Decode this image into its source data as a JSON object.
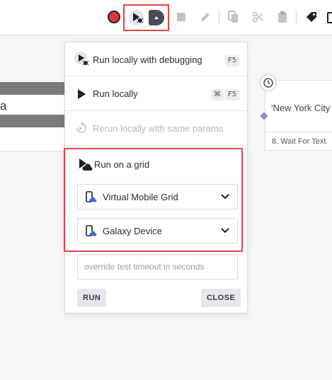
{
  "toolbar": {
    "icons": [
      "record-icon",
      "run-debug-icon",
      "dropdown-arrow-icon",
      "stop-icon",
      "pencil-icon",
      "copy-icon",
      "scissors-icon",
      "clipboard-icon",
      "tag-icon"
    ],
    "record_color": "#e8323c",
    "highlight_color": "#e24646"
  },
  "canvas": {
    "left_node_text": "a",
    "right_node_text": "'New York City",
    "right_node_step": "8. Wait For Text"
  },
  "menu": {
    "items": [
      {
        "label": "Run locally with debugging",
        "shortcut": "F5"
      },
      {
        "label": "Run locally",
        "shortcut_mod": "⌘",
        "shortcut": "F5"
      },
      {
        "label": "Rerun locally with same params",
        "disabled": true
      }
    ],
    "grid": {
      "title": "Run on a grid",
      "grid_select": "Virtual Mobile Grid",
      "device_select": "Galaxy Device"
    },
    "timeout_placeholder": "override test timeout in seconds",
    "run_label": "RUN",
    "close_label": "CLOSE"
  }
}
